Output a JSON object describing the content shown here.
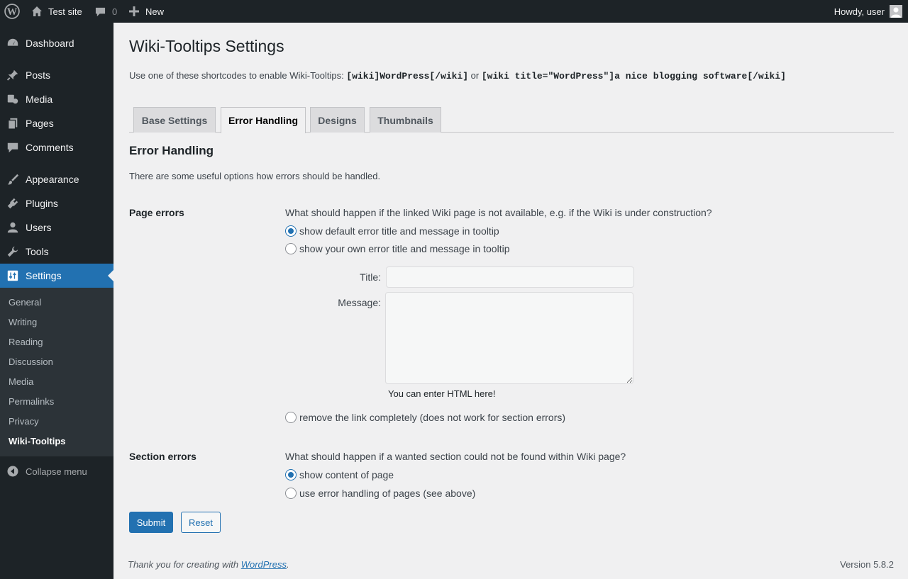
{
  "admin_bar": {
    "site_name": "Test site",
    "comments_count": "0",
    "new_label": "New",
    "howdy": "Howdy, user"
  },
  "sidebar": {
    "items": [
      {
        "label": "Dashboard",
        "icon": "dashboard-icon"
      },
      {
        "label": "Posts",
        "icon": "pin-icon"
      },
      {
        "label": "Media",
        "icon": "media-icon"
      },
      {
        "label": "Pages",
        "icon": "pages-icon"
      },
      {
        "label": "Comments",
        "icon": "comment-icon"
      },
      {
        "label": "Appearance",
        "icon": "paintbrush-icon"
      },
      {
        "label": "Plugins",
        "icon": "plugin-icon"
      },
      {
        "label": "Users",
        "icon": "users-icon"
      },
      {
        "label": "Tools",
        "icon": "wrench-icon"
      },
      {
        "label": "Settings",
        "icon": "settings-icon"
      }
    ],
    "submenu": [
      "General",
      "Writing",
      "Reading",
      "Discussion",
      "Media",
      "Permalinks",
      "Privacy",
      "Wiki-Tooltips"
    ],
    "collapse_label": "Collapse menu"
  },
  "page": {
    "title": "Wiki-Tooltips Settings",
    "intro_text": "Use one of these shortcodes to enable Wiki-Tooltips:",
    "shortcode_1": "[wiki]WordPress[/wiki]",
    "intro_or": "or",
    "shortcode_2": "[wiki title=\"WordPress\"]a nice blogging software[/wiki]",
    "tabs": [
      "Base Settings",
      "Error Handling",
      "Designs",
      "Thumbnails"
    ],
    "active_tab": "Error Handling",
    "section_title": "Error Handling",
    "section_desc": "There are some useful options how errors should be handled.",
    "page_errors": {
      "label": "Page errors",
      "question": "What should happen if the linked Wiki page is not available, e.g. if the Wiki is under construction?",
      "options": [
        "show default error title and message in tooltip",
        "show your own error title and message in tooltip",
        "remove the link completely (does not work for section errors)"
      ],
      "selected": 0,
      "title_label": "Title:",
      "title_value": "",
      "message_label": "Message:",
      "message_value": "",
      "hint": "You can enter HTML here!"
    },
    "section_errors": {
      "label": "Section errors",
      "question": "What should happen if a wanted section could not be found within Wiki page?",
      "options": [
        "show content of page",
        "use error handling of pages (see above)"
      ],
      "selected": 0
    },
    "submit_label": "Submit",
    "reset_label": "Reset"
  },
  "footer": {
    "thanks_prefix": "Thank you for creating with",
    "thanks_link": "WordPress",
    "thanks_suffix": ".",
    "version": "Version 5.8.2"
  },
  "colors": {
    "accent": "#2271b1",
    "admin_bg": "#1d2327",
    "content_bg": "#f0f0f1"
  }
}
